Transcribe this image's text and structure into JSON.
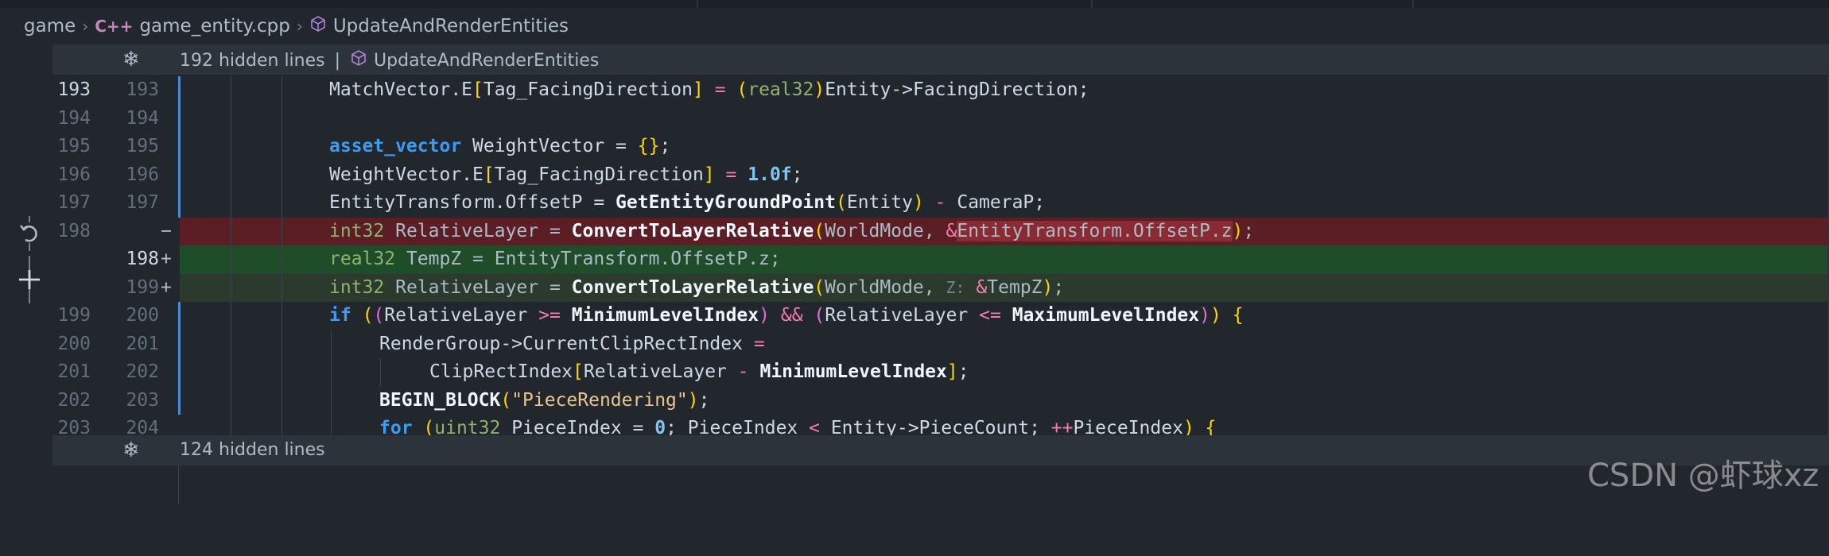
{
  "breadcrumb": {
    "items": [
      "game",
      "game_entity.cpp",
      "UpdateAndRenderEntities"
    ],
    "cpp_badge": "C++"
  },
  "hidden_top": {
    "text": "192 hidden lines",
    "separator": "|",
    "symbol": "UpdateAndRenderEntities"
  },
  "hidden_bottom": {
    "text": "124 hidden lines"
  },
  "gutter_icons": [
    "revert-icon",
    "add-icon"
  ],
  "watermark": "CSDN @虾球xz",
  "colors": {
    "deleted_bg": "#5b1e24",
    "added_bg": "#1f4d2a",
    "modified_bar": "#4a8bd6"
  },
  "lines": [
    {
      "old": "193",
      "new": "193",
      "type": "context",
      "current": true
    },
    {
      "old": "194",
      "new": "194",
      "type": "context"
    },
    {
      "old": "195",
      "new": "195",
      "type": "context"
    },
    {
      "old": "196",
      "new": "196",
      "type": "context"
    },
    {
      "old": "197",
      "new": "197",
      "type": "context"
    },
    {
      "old": "198",
      "new": "",
      "type": "deleted",
      "marker": "−"
    },
    {
      "old": "",
      "new": "198",
      "type": "added",
      "marker": "+",
      "current": true
    },
    {
      "old": "",
      "new": "199",
      "type": "added",
      "marker": "+"
    },
    {
      "old": "199",
      "new": "200",
      "type": "context"
    },
    {
      "old": "200",
      "new": "201",
      "type": "context"
    },
    {
      "old": "201",
      "new": "202",
      "type": "context"
    },
    {
      "old": "202",
      "new": "203",
      "type": "context"
    },
    {
      "old": "203",
      "new": "204",
      "type": "context"
    }
  ],
  "code": {
    "l0": [
      "MatchVector.E",
      "[",
      "Tag_FacingDirection",
      "]",
      " = ",
      "(",
      "real32",
      ")",
      "Entity->FacingDirection;"
    ],
    "l1": [],
    "l2": [
      "asset_vector",
      " WeightVector = ",
      "{}",
      ";"
    ],
    "l3": [
      "WeightVector.E",
      "[",
      "Tag_FacingDirection",
      "]",
      " = ",
      "1.0f",
      ";"
    ],
    "l4": [
      "EntityTransform.OffsetP = ",
      "GetEntityGroundPoint",
      "(",
      "Entity",
      ")",
      " - ",
      "CameraP;"
    ],
    "l5": [
      "int32",
      " RelativeLayer = ",
      "ConvertToLayerRelative",
      "(",
      "WorldMode, ",
      "&",
      "EntityTransform.OffsetP.z",
      ")",
      ";"
    ],
    "l6": [
      "real32",
      " TempZ = EntityTransform.OffsetP.z;"
    ],
    "l7": [
      "int32",
      " RelativeLayer = ",
      "ConvertToLayerRelative",
      "(",
      "WorldMode, ",
      "Z:",
      " ",
      "&",
      "TempZ",
      ")",
      ";"
    ],
    "l8": [
      "if",
      " ",
      "(",
      "(",
      "RelativeLayer ",
      ">=",
      " ",
      "MinimumLevelIndex",
      ")",
      " ",
      "&&",
      " ",
      "(",
      "RelativeLayer ",
      "<=",
      " ",
      "MaximumLevelIndex",
      ")",
      ")",
      " ",
      "{"
    ],
    "l9": [
      "RenderGroup->CurrentClipRectIndex ",
      "="
    ],
    "l10": [
      "ClipRectIndex",
      "[",
      "RelativeLayer ",
      "-",
      " ",
      "MinimumLevelIndex",
      "]",
      ";"
    ],
    "l11": [
      "BEGIN_BLOCK",
      "(",
      "\"PieceRendering\"",
      ")",
      ";"
    ],
    "l12": [
      "for",
      " ",
      "(",
      "uint32",
      " PieceIndex = ",
      "0",
      "; PieceIndex ",
      "<",
      " Entity->PieceCount; ",
      "++",
      "PieceIndex",
      ")",
      " ",
      "{"
    ]
  }
}
